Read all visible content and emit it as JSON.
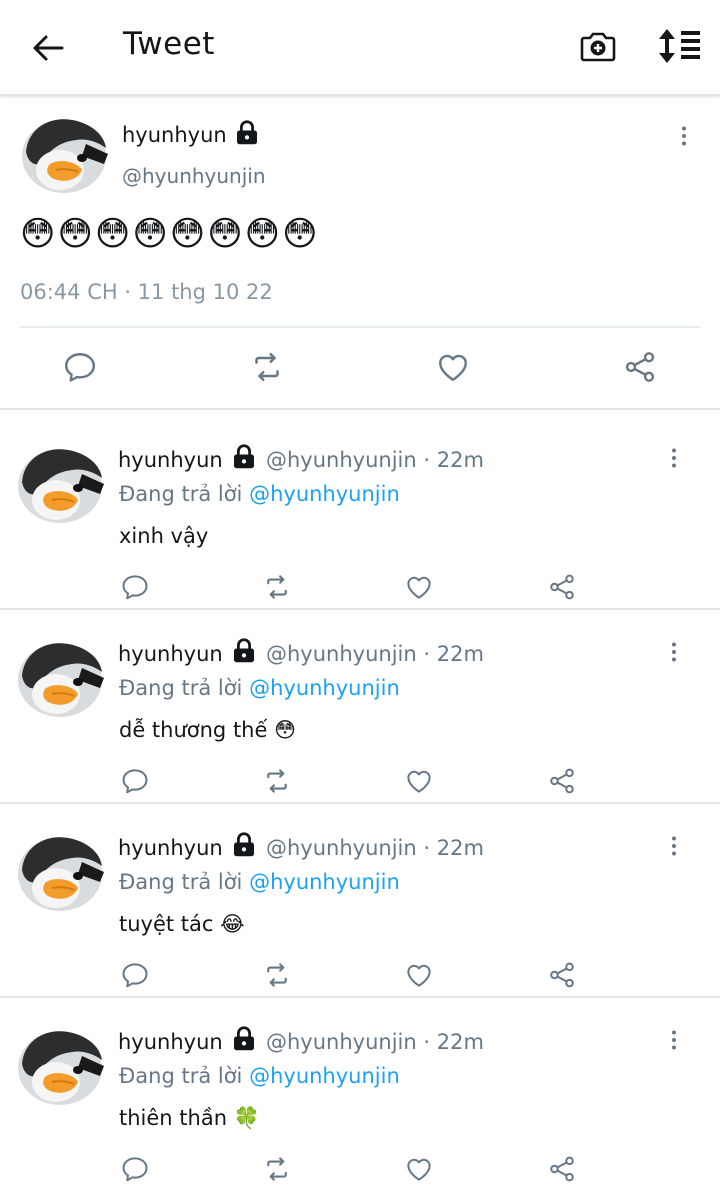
{
  "header": {
    "title": "Tweet"
  },
  "main_tweet": {
    "name": "hyunhyun",
    "handle": "@hyunhyunjin",
    "text": "😳😳😳😳😳😳😳😳",
    "timestamp": "06:44 CH · 11 thg 10 22"
  },
  "replies": [
    {
      "name": "hyunhyun",
      "handle": "@hyunhyunjin",
      "time": "· 22m",
      "replying_prefix": "Đang trả lời",
      "replying_to": "@hyunhyunjin",
      "text": "xinh vậy"
    },
    {
      "name": "hyunhyun",
      "handle": "@hyunhyunjin",
      "time": "· 22m",
      "replying_prefix": "Đang trả lời",
      "replying_to": "@hyunhyunjin",
      "text": "dễ thương thế 😳"
    },
    {
      "name": "hyunhyun",
      "handle": "@hyunhyunjin",
      "time": "· 22m",
      "replying_prefix": "Đang trả lời",
      "replying_to": "@hyunhyunjin",
      "text": "tuyệt tác 😂"
    },
    {
      "name": "hyunhyun",
      "handle": "@hyunhyunjin",
      "time": "· 22m",
      "replying_prefix": "Đang trả lời",
      "replying_to": "@hyunhyunjin",
      "text": "thiên thần 🍀"
    }
  ],
  "colors": {
    "link": "#1da1f2",
    "secondary": "#657786",
    "icon": "#657786"
  },
  "icons": [
    "back-arrow-icon",
    "camera-icon",
    "sort-icon",
    "lock-icon",
    "more-vertical-icon",
    "reply-icon",
    "retweet-icon",
    "like-icon",
    "share-icon"
  ]
}
